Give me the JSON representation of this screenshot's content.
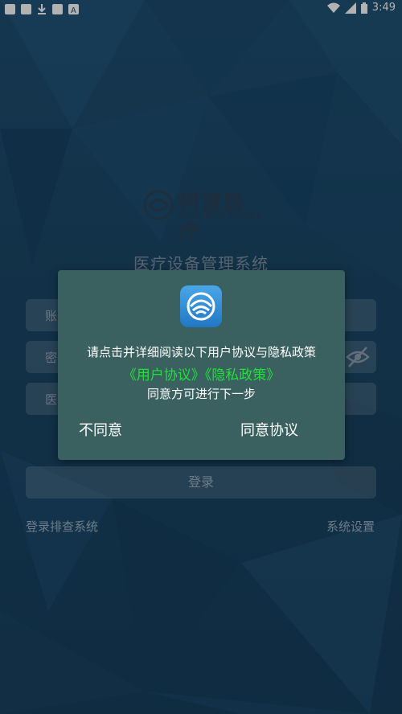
{
  "status_bar": {
    "time": "3:49",
    "icons": [
      "notification-square-icon",
      "notification-square-icon",
      "download-icon",
      "notification-square-icon",
      "a-badge-icon",
      "wifi-icon",
      "signal-icon",
      "battery-icon"
    ]
  },
  "login": {
    "brand_name": "柯渡医疗",
    "brand_sub": "KEDU HEALTHCARE",
    "system_title": "医疗设备管理系统",
    "account_label": "账",
    "password_label": "密",
    "hospital_label": "医",
    "login_button": "登录",
    "troubleshoot_link": "登录排查系统",
    "settings_link": "系统设置"
  },
  "dialog": {
    "line1": "请点击并详细阅读以下用户协议与隐私政策",
    "user_agreement_link": "《用户协议》",
    "privacy_policy_link": "《隐私政策》",
    "line3": "同意方可进行下一步",
    "disagree_button": "不同意",
    "agree_button": "同意协议"
  },
  "colors": {
    "dialog_bg": "#3a6060",
    "link_green": "#20e03a",
    "background_blue": "#1e4f72"
  }
}
